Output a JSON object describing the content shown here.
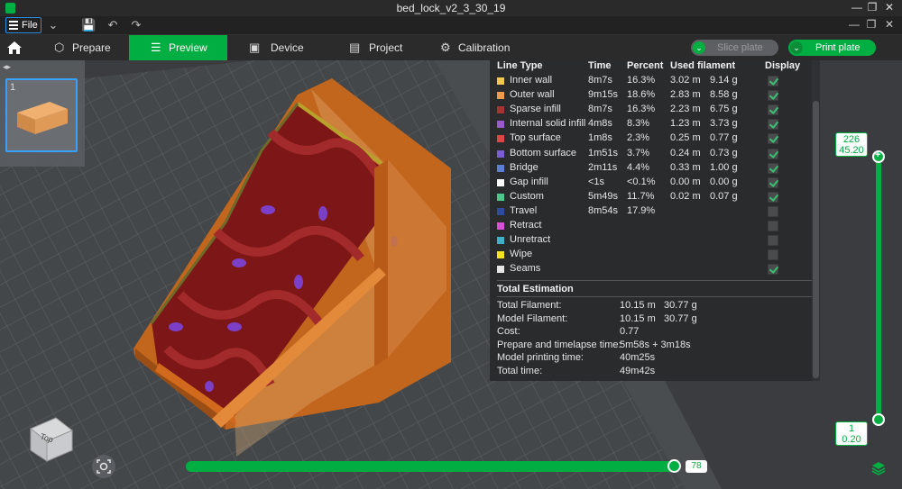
{
  "window": {
    "title": "bed_lock_v2_3_30_19"
  },
  "menubar": {
    "file_label": "File"
  },
  "tabs": [
    {
      "label": "Prepare",
      "active": false
    },
    {
      "label": "Preview",
      "active": true
    },
    {
      "label": "Device",
      "active": false
    },
    {
      "label": "Project",
      "active": false
    },
    {
      "label": "Calibration",
      "active": false
    }
  ],
  "actions": {
    "slice_plate": "Slice plate",
    "print_plate": "Print plate"
  },
  "thumbnail": {
    "plate_number": "1"
  },
  "legend": {
    "headers": {
      "line_type": "Line Type",
      "time": "Time",
      "percent": "Percent",
      "used_filament": "Used filament",
      "display": "Display"
    },
    "rows": [
      {
        "name": "Inner wall",
        "color": "#f2c94c",
        "time": "8m7s",
        "percent": "16.3%",
        "length": "3.02 m",
        "weight": "9.14 g",
        "display": true
      },
      {
        "name": "Outer wall",
        "color": "#f2994a",
        "time": "9m15s",
        "percent": "18.6%",
        "length": "2.83 m",
        "weight": "8.58 g",
        "display": true
      },
      {
        "name": "Sparse infill",
        "color": "#a83232",
        "time": "8m7s",
        "percent": "16.3%",
        "length": "2.23 m",
        "weight": "6.75 g",
        "display": true
      },
      {
        "name": "Internal solid infill",
        "color": "#9b59d0",
        "time": "4m8s",
        "percent": "8.3%",
        "length": "1.23 m",
        "weight": "3.73 g",
        "display": true
      },
      {
        "name": "Top surface",
        "color": "#e04545",
        "time": "1m8s",
        "percent": "2.3%",
        "length": "0.25 m",
        "weight": "0.77 g",
        "display": true
      },
      {
        "name": "Bottom surface",
        "color": "#7a5cd6",
        "time": "1m51s",
        "percent": "3.7%",
        "length": "0.24 m",
        "weight": "0.73 g",
        "display": true
      },
      {
        "name": "Bridge",
        "color": "#5b7fd6",
        "time": "2m11s",
        "percent": "4.4%",
        "length": "0.33 m",
        "weight": "1.00 g",
        "display": true
      },
      {
        "name": "Gap infill",
        "color": "#ffffff",
        "time": "<1s",
        "percent": "<0.1%",
        "length": "0.00 m",
        "weight": "0.00 g",
        "display": true
      },
      {
        "name": "Custom",
        "color": "#4cc98a",
        "time": "5m49s",
        "percent": "11.7%",
        "length": "0.02 m",
        "weight": "0.07 g",
        "display": true
      },
      {
        "name": "Travel",
        "color": "#2d4ba0",
        "time": "8m54s",
        "percent": "17.9%",
        "length": "",
        "weight": "",
        "display": false
      },
      {
        "name": "Retract",
        "color": "#d94fd9",
        "time": "",
        "percent": "",
        "length": "",
        "weight": "",
        "display": false
      },
      {
        "name": "Unretract",
        "color": "#3fb0c9",
        "time": "",
        "percent": "",
        "length": "",
        "weight": "",
        "display": false
      },
      {
        "name": "Wipe",
        "color": "#f5e323",
        "time": "",
        "percent": "",
        "length": "",
        "weight": "",
        "display": false
      },
      {
        "name": "Seams",
        "color": "#e6e6e6",
        "time": "",
        "percent": "",
        "length": "",
        "weight": "",
        "display": true
      }
    ],
    "estimation": {
      "title": "Total Estimation",
      "rows": [
        {
          "label": "Total Filament:",
          "value1": "10.15 m",
          "value2": "30.77 g"
        },
        {
          "label": "Model Filament:",
          "value1": "10.15 m",
          "value2": "30.77 g"
        },
        {
          "label": "Cost:",
          "value1": "0.77",
          "value2": ""
        },
        {
          "label": "Prepare and timelapse time:",
          "value1": "5m58s + 3m18s",
          "value2": ""
        },
        {
          "label": "Model printing time:",
          "value1": "40m25s",
          "value2": ""
        },
        {
          "label": "Total time:",
          "value1": "49m42s",
          "value2": ""
        }
      ]
    }
  },
  "layer_slider": {
    "top_layer": "226",
    "top_height": "45.20",
    "bottom_layer": "1",
    "bottom_height": "0.20"
  },
  "move_slider": {
    "value": "78"
  },
  "view_cube": {
    "face_label": "Top"
  },
  "colors": {
    "accent": "#00ae42",
    "selection": "#3aa0ff"
  }
}
